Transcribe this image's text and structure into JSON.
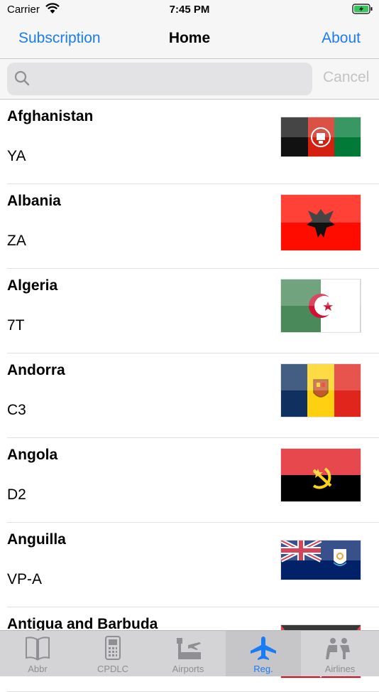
{
  "status_bar": {
    "carrier": "Carrier",
    "time": "7:45 PM"
  },
  "nav": {
    "left_label": "Subscription",
    "title": "Home",
    "right_label": "About"
  },
  "search": {
    "placeholder": "",
    "cancel_label": "Cancel"
  },
  "countries": [
    {
      "name": "Afghanistan",
      "code": "YA",
      "flag": "afghanistan-flag"
    },
    {
      "name": "Albania",
      "code": "ZA",
      "flag": "albania-flag"
    },
    {
      "name": "Algeria",
      "code": "7T",
      "flag": "algeria-flag"
    },
    {
      "name": "Andorra",
      "code": "C3",
      "flag": "andorra-flag"
    },
    {
      "name": "Angola",
      "code": "D2",
      "flag": "angola-flag"
    },
    {
      "name": "Anguilla",
      "code": "VP-A",
      "flag": "anguilla-flag"
    },
    {
      "name": "Antigua and Barbuda",
      "code": "",
      "flag": "antigua-and-barbuda-flag"
    }
  ],
  "tabs": [
    {
      "label": "Abbr",
      "icon": "book-icon"
    },
    {
      "label": "CPDLC",
      "icon": "device-icon"
    },
    {
      "label": "Airports",
      "icon": "airport-icon"
    },
    {
      "label": "Reg.",
      "icon": "airplane-icon",
      "active": true
    },
    {
      "label": "Airlines",
      "icon": "passengers-icon"
    }
  ],
  "colors": {
    "accent": "#1a7cf5",
    "inactive_tab": "#8e8e93",
    "cancel_disabled": "#c3c3c7"
  }
}
